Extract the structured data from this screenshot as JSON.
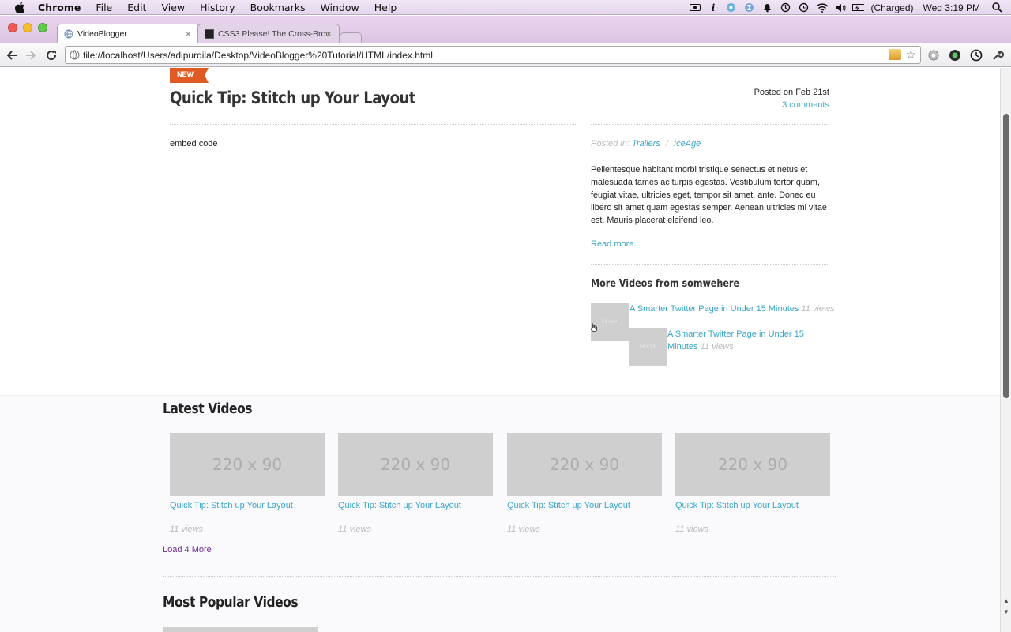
{
  "menubar": {
    "app": "Chrome",
    "items": [
      "File",
      "Edit",
      "View",
      "History",
      "Bookmarks",
      "Window",
      "Help"
    ],
    "battery": "(Charged)",
    "clock": "Wed 3:19 PM"
  },
  "tabs": [
    {
      "title": "VideoBlogger",
      "active": true
    },
    {
      "title": "CSS3 Please! The Cross-Brow",
      "active": false
    }
  ],
  "toolbar": {
    "url": "file://localhost/Users/adipurdila/Desktop/VideoBlogger%20Tutorial/HTML/index.html"
  },
  "post": {
    "badge": "NEW",
    "title": "Quick Tip: Stitch up Your Layout",
    "posted_on": "Posted on Feb 21st",
    "comments": "3 comments",
    "embed": "embed code",
    "posted_in_label": "Posted in:",
    "categories": [
      "Trailers",
      "IceAge"
    ],
    "category_sep": "/",
    "excerpt": "Pellentesque habitant morbi tristique senectus et netus et malesuada fames ac turpis egestas. Vestibulum tortor quam, feugiat vitae, ultricies eget, tempor sit amet, ante. Donec eu libero sit amet quam egestas semper. Aenean ultricies mi vitae est. Mauris placerat eleifend leo.",
    "read_more": "Read more..."
  },
  "more_videos": {
    "heading": "More Videos from somwehere",
    "items": [
      {
        "title": "A Smarter Twitter Page in Under 15 Minutes",
        "views": "11 views",
        "thumb": "54 x 54"
      },
      {
        "title": "A Smarter Twitter Page in Under 15 Minutes",
        "views": "11 views",
        "thumb": "54 x 54"
      }
    ]
  },
  "latest": {
    "heading": "Latest Videos",
    "cards": [
      {
        "img": "220 x 90",
        "title": "Quick Tip: Stitch up Your Layout",
        "views": "11 views"
      },
      {
        "img": "220 x 90",
        "title": "Quick Tip: Stitch up Your Layout",
        "views": "11 views"
      },
      {
        "img": "220 x 90",
        "title": "Quick Tip: Stitch up Your Layout",
        "views": "11 views"
      },
      {
        "img": "220 x 90",
        "title": "Quick Tip: Stitch up Your Layout",
        "views": "11 views"
      }
    ],
    "load_more": "Load 4 More"
  },
  "popular": {
    "heading": "Most Popular Videos"
  },
  "colors": {
    "link": "#3aa6c9",
    "badge": "#e05a24",
    "visited": "#6b2d8a"
  }
}
